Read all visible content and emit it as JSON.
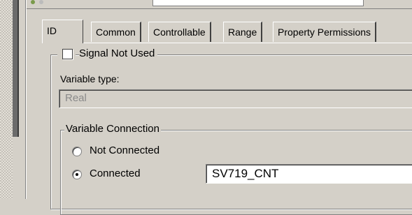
{
  "tabs": [
    {
      "label": "ID"
    },
    {
      "label": "Common"
    },
    {
      "label": "Controllable"
    },
    {
      "label": "Range"
    },
    {
      "label": "Property Permissions"
    }
  ],
  "signal_not_used": {
    "label": "Signal Not Used",
    "checked": false
  },
  "variable_type": {
    "label": "Variable type:",
    "value": "Real"
  },
  "connection": {
    "group_label": "Variable Connection",
    "not_connected_label": "Not Connected",
    "connected_label": "Connected",
    "selected": "Connected",
    "connected_value": "SV719_CNT"
  }
}
